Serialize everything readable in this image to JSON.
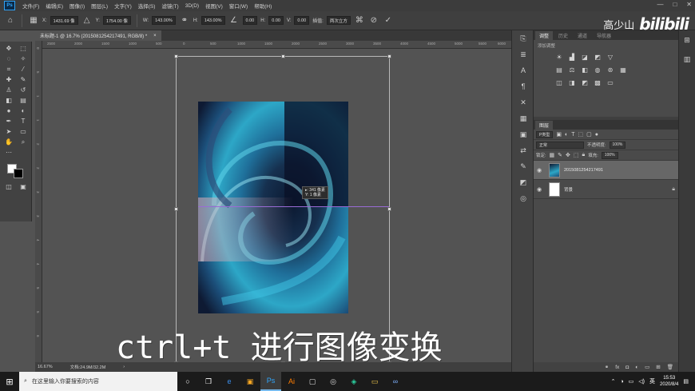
{
  "app": {
    "logo": "Ps",
    "menus": [
      "文件(F)",
      "编辑(E)",
      "图像(I)",
      "图层(L)",
      "文字(Y)",
      "选择(S)",
      "滤镜(T)",
      "3D(D)",
      "视图(V)",
      "窗口(W)",
      "帮助(H)"
    ],
    "window_controls": [
      "—",
      "□",
      "✕"
    ]
  },
  "options_bar": {
    "x_label": "X:",
    "x_value": "1431.69 像",
    "y_label": "Y:",
    "y_value": "1754.00 像",
    "w_label": "W:",
    "w_value": "143.00%",
    "h_label": "H:",
    "h_value": "143.00%",
    "angle_value": "0.00",
    "hskew_label": "H:",
    "hskew_value": "0.00",
    "vskew_label": "V:",
    "vskew_value": "0.00",
    "interp_label": "插值:",
    "interp_value": "两次立方"
  },
  "watermark": {
    "text": "高少山",
    "logo": "bilibili"
  },
  "document": {
    "tab_title": "未标题-1 @ 16.7% (20150812542174​91, RGB/8) *",
    "close": "×"
  },
  "ruler": {
    "top_ticks": [
      "2500",
      "2000",
      "1500",
      "1000",
      "500",
      "0",
      "500",
      "1000",
      "1500",
      "2000",
      "2500",
      "3000",
      "3500",
      "4000",
      "4500",
      "5000",
      "5500",
      "6000"
    ],
    "left_ticks": [
      "0",
      "5",
      "1",
      "1",
      "2",
      "2",
      "3",
      "3",
      "4",
      "4",
      "5",
      "5",
      "6"
    ]
  },
  "transform_info": {
    "line1": "▸: 341 像素",
    "line2": "Y: 1 像素"
  },
  "status": {
    "zoom": "16.67%",
    "doc": "文档:24.9M/32.2M",
    "arrow": "›"
  },
  "subtitle": "ctrl+t 进行图像变换",
  "panels": {
    "top_tabs": [
      "调整",
      "历史",
      "通道",
      "导航器"
    ],
    "adjust_hint": "添加调整",
    "layers_tab": "图层",
    "filter_kind": "P类型",
    "blend_mode": "正常",
    "opacity_label": "不透明度:",
    "opacity_value": "100%",
    "lock_label": "锁定:",
    "fill_label": "填充:",
    "fill_value": "100%",
    "layers": [
      {
        "name": "20150812542174​91",
        "selected": true
      },
      {
        "name": "背景",
        "selected": false
      }
    ]
  },
  "taskbar": {
    "search_placeholder": "在这里输入你要搜索的内容",
    "ime": "英",
    "time": "15:53",
    "date": "2020/8/4"
  },
  "colors": {
    "accent": "#2fa3f7",
    "guide": "#9a6bd6",
    "panel_bg": "#3f3f3f",
    "canvas_bg": "#535353"
  }
}
